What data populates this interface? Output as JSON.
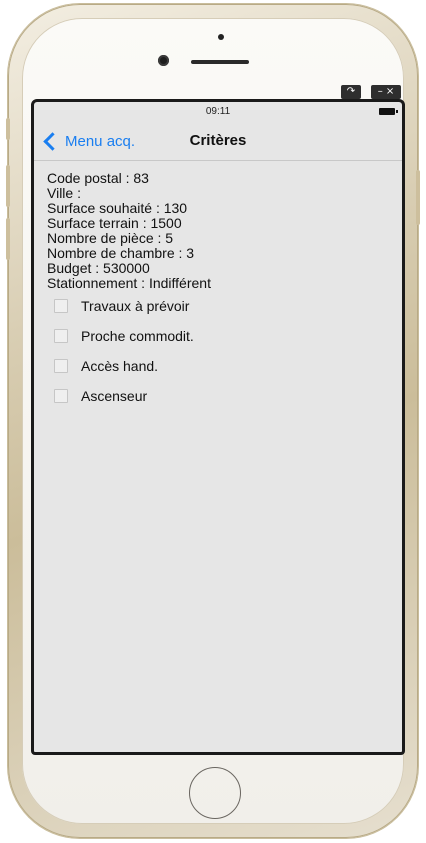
{
  "status_bar": {
    "time": "09:11"
  },
  "nav": {
    "back_label": "Menu acq.",
    "title": "Critères"
  },
  "criteria": [
    "Code postal : 83",
    "Ville :",
    "Surface souhaité : 130",
    "Surface terrain : 1500",
    "Nombre de pièce : 5",
    "Nombre de chambre : 3",
    "Budget : 530000",
    "Stationnement : Indifférent"
  ],
  "options": [
    {
      "label": "Travaux à prévoir",
      "checked": false
    },
    {
      "label": "Proche commodit.",
      "checked": false
    },
    {
      "label": "Accès hand.",
      "checked": false
    },
    {
      "label": "Ascenseur",
      "checked": false
    }
  ],
  "window_controls": {
    "rotate_icon": "↷",
    "minimize_icon": "–",
    "close_icon": "×"
  },
  "colors": {
    "accent": "#1a7ef0",
    "screen_bg": "#e6e6e6",
    "phone_frame": "#d8cdb2"
  }
}
